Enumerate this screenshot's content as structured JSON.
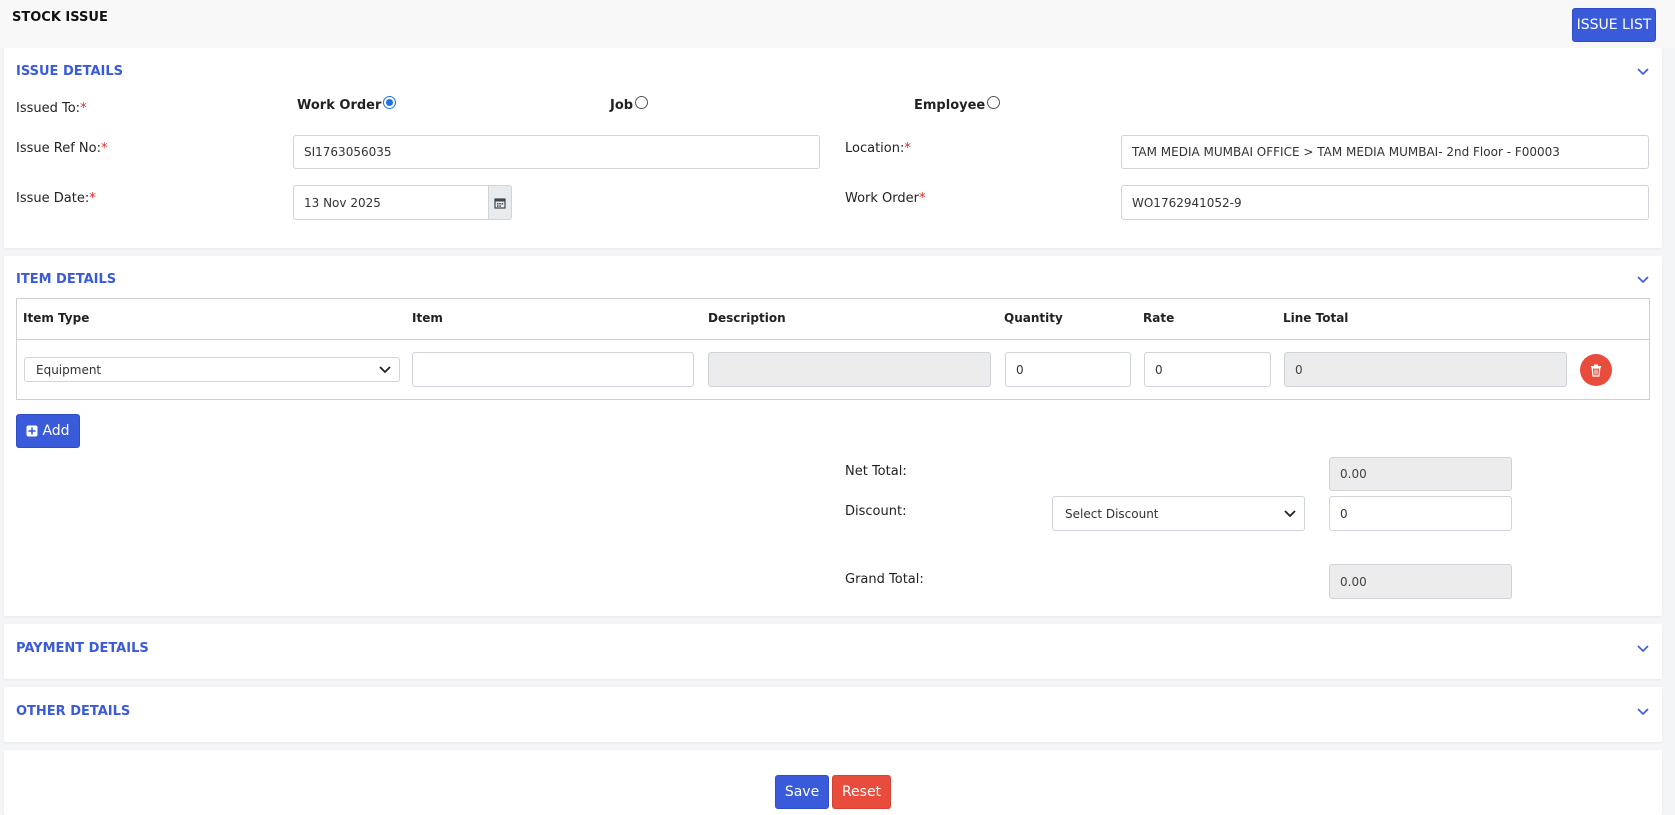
{
  "header": {
    "title": "STOCK ISSUE",
    "issue_list_label": "ISSUE LIST"
  },
  "issue_details": {
    "title": "ISSUE DETAILS",
    "issued_to_label": "Issued To:",
    "radio_options": [
      {
        "label": "Work Order",
        "selected": true
      },
      {
        "label": "Job",
        "selected": false
      },
      {
        "label": "Employee",
        "selected": false
      }
    ],
    "issue_ref_label": "Issue Ref No:",
    "issue_ref_value": "SI1763056035",
    "location_label": "Location:",
    "location_value": "TAM MEDIA MUMBAI OFFICE > TAM MEDIA MUMBAI- 2nd Floor - F00003",
    "issue_date_label": "Issue Date:",
    "issue_date_value": "13 Nov 2025",
    "work_order_label": "Work Order",
    "work_order_value": "WO1762941052-9",
    "required_mark": "*"
  },
  "item_details": {
    "title": "ITEM DETAILS",
    "columns": [
      "Item Type",
      "Item",
      "Description",
      "Quantity",
      "Rate",
      "Line Total"
    ],
    "row": {
      "item_type": "Equipment",
      "item": "",
      "description": "",
      "quantity": "0",
      "rate": "0",
      "line_total": "0"
    },
    "add_label": "Add",
    "net_total_label": "Net Total:",
    "net_total_value": "0.00",
    "discount_label": "Discount:",
    "discount_select": "Select Discount",
    "discount_value": "0",
    "grand_total_label": "Grand Total:",
    "grand_total_value": "0.00"
  },
  "payment_details": {
    "title": "PAYMENT DETAILS"
  },
  "other_details": {
    "title": "OTHER DETAILS"
  },
  "footer": {
    "save_label": "Save",
    "reset_label": "Reset"
  },
  "colors": {
    "accent": "#3a5bd9",
    "danger": "#e74c3c",
    "radio": "#1a73e8"
  }
}
